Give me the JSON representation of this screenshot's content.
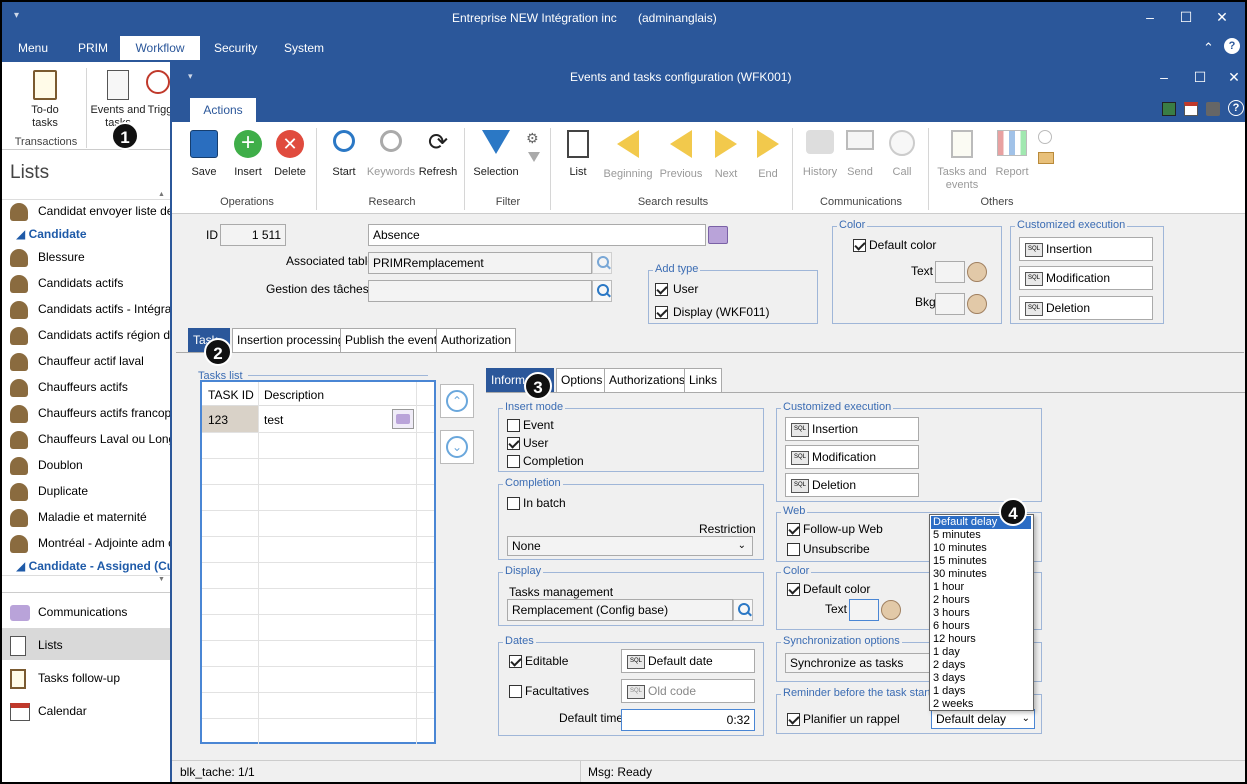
{
  "outer": {
    "title": "Entreprise NEW Intégration inc",
    "user": "(adminanglais)",
    "menu": [
      "Menu",
      "PRIM",
      "Workflow",
      "Security",
      "System"
    ],
    "ribbon": {
      "todo": "To-do tasks",
      "events": "Events and tasks",
      "trig": "Trigg",
      "group": "Transactions"
    }
  },
  "sidebar": {
    "title": "Lists",
    "items": [
      "Candidat envoyer liste de",
      "Blessure",
      "Candidats actifs",
      "Candidats actifs - Intégrat",
      "Candidats actifs région de",
      "Chauffeur actif laval",
      "Chauffeurs actifs",
      "Chauffeurs actifs francopl",
      "Chauffeurs Laval ou Long",
      "Doublon",
      "Duplicate",
      "Maladie et maternité",
      "Montréal - Adjointe adm c"
    ],
    "header1": "Candidate",
    "header2": "Candidate - Assigned (Curr",
    "nav": [
      "Communications",
      "Lists",
      "Tasks follow-up",
      "Calendar"
    ]
  },
  "dialog": {
    "title": "Events and tasks configuration (WFK001)",
    "tab": "Actions",
    "ribbon": {
      "operations": {
        "label": "Operations",
        "save": "Save",
        "insert": "Insert",
        "delete": "Delete"
      },
      "research": {
        "label": "Research",
        "start": "Start",
        "keywords": "Keywords",
        "refresh": "Refresh"
      },
      "filter": {
        "label": "Filter",
        "selection": "Selection"
      },
      "search_results": {
        "label": "Search results",
        "list": "List",
        "beginning": "Beginning",
        "previous": "Previous",
        "next": "Next",
        "end": "End"
      },
      "communications": {
        "label": "Communications",
        "history": "History",
        "send": "Send",
        "call": "Call"
      },
      "others": {
        "label": "Others",
        "tasks": "Tasks and events",
        "report": "Report"
      }
    },
    "form": {
      "id_label": "ID",
      "id_value": "1 511",
      "name_value": "Absence",
      "assoc_label": "Associated table",
      "assoc_value": "PRIMRemplacement",
      "gestion_label": "Gestion des tâches",
      "gestion_value": "",
      "add_type": {
        "title": "Add type",
        "user": "User",
        "display": "Display (WKF011)"
      },
      "color": {
        "title": "Color",
        "default": "Default color",
        "text": "Text",
        "bkg": "Bkg"
      },
      "custom_exec": {
        "title": "Customized execution",
        "insertion": "Insertion",
        "modification": "Modification",
        "deletion": "Deletion"
      }
    },
    "tabs": [
      "Task",
      "Insertion processing",
      "Publish the event",
      "Authorization"
    ],
    "tasks_list": {
      "title": "Tasks list",
      "col_id": "TASK ID",
      "col_desc": "Description",
      "rows": [
        {
          "id": "123",
          "desc": "test"
        }
      ]
    },
    "inner_tabs": [
      "Information",
      "Options",
      "Authorizations",
      "Links"
    ],
    "insert_mode": {
      "title": "Insert mode",
      "event": "Event",
      "user": "User",
      "completion": "Completion"
    },
    "completion": {
      "title": "Completion",
      "in_batch": "In batch",
      "restriction": "Restriction",
      "value": "None"
    },
    "display": {
      "title": "Display",
      "tasks_mgmt": "Tasks management",
      "value": "Remplacement (Config base)"
    },
    "dates": {
      "title": "Dates",
      "editable": "Editable",
      "default_date": "Default date",
      "facultatives": "Facultatives",
      "old_code": "Old code",
      "default_time": "Default time",
      "time_value": "0:32"
    },
    "custom_exec2": {
      "title": "Customized execution",
      "insertion": "Insertion",
      "modification": "Modification",
      "deletion": "Deletion"
    },
    "web": {
      "title": "Web",
      "followup": "Follow-up Web",
      "unsubscribe": "Unsubscribe"
    },
    "color2": {
      "title": "Color",
      "default": "Default color",
      "text": "Text"
    },
    "sync": {
      "title": "Synchronization options",
      "value": "Synchronize as tasks"
    },
    "reminder": {
      "title": "Reminder before the task starts",
      "planifier": "Planifier un rappel",
      "value": "Default delay"
    },
    "dropdown": [
      "Default delay",
      "5 minutes",
      "10 minutes",
      "15 minutes",
      "30 minutes",
      "1 hour",
      "2 hours",
      "3 hours",
      "6 hours",
      "12 hours",
      "1 day",
      "2 days",
      "3 days",
      "1 days",
      "2 weeks"
    ],
    "status": {
      "left": "blk_tache: 1/1",
      "right": "Msg: Ready"
    }
  },
  "badges": [
    "1",
    "2",
    "3",
    "4"
  ],
  "colors": {
    "accent": "#2b579a",
    "selected": "#2b6cc4",
    "group_title": "#3b6cb3"
  }
}
